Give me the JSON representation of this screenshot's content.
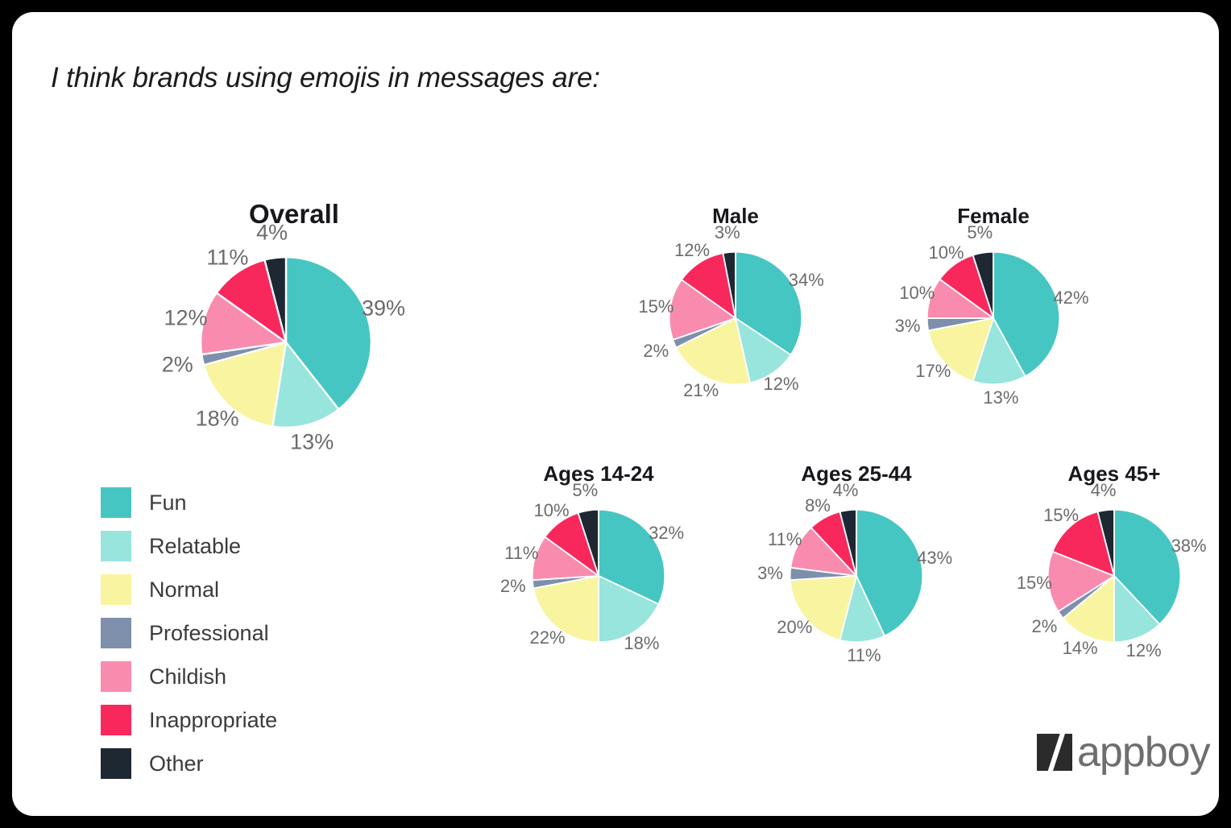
{
  "title": "I think brands using emojis in messages are:",
  "logo": {
    "text": "appboy",
    "mark": "appboy-slash-mark"
  },
  "legend": {
    "items": [
      {
        "label": "Fun",
        "color": "#46C6C2"
      },
      {
        "label": "Relatable",
        "color": "#97E5DC"
      },
      {
        "label": "Normal",
        "color": "#F9F4A0"
      },
      {
        "label": "Professional",
        "color": "#7E8FAB"
      },
      {
        "label": "Childish",
        "color": "#F98CAE"
      },
      {
        "label": "Inappropriate",
        "color": "#F8285C"
      },
      {
        "label": "Other",
        "color": "#1E2833"
      }
    ]
  },
  "chart_data": [
    {
      "type": "pie",
      "title": "Overall",
      "categories": [
        "Fun",
        "Relatable",
        "Normal",
        "Professional",
        "Childish",
        "Inappropriate",
        "Other"
      ],
      "values": [
        39,
        13,
        18,
        2,
        12,
        11,
        4
      ],
      "labels": [
        "39%",
        "13%",
        "18%",
        "2%",
        "12%",
        "11%",
        "4%"
      ],
      "colors": [
        "#46C6C2",
        "#97E5DC",
        "#F9F4A0",
        "#7E8FAB",
        "#F98CAE",
        "#F8285C",
        "#1E2833"
      ],
      "start_angle_deg": 0,
      "direction": "clockwise",
      "units": "percent"
    },
    {
      "type": "pie",
      "title": "Male",
      "categories": [
        "Fun",
        "Relatable",
        "Normal",
        "Professional",
        "Childish",
        "Inappropriate",
        "Other"
      ],
      "values": [
        34,
        12,
        21,
        2,
        15,
        12,
        3
      ],
      "labels": [
        "34%",
        "12%",
        "21%",
        "2%",
        "15%",
        "12%",
        "3%"
      ],
      "colors": [
        "#46C6C2",
        "#97E5DC",
        "#F9F4A0",
        "#7E8FAB",
        "#F98CAE",
        "#F8285C",
        "#1E2833"
      ],
      "start_angle_deg": 0,
      "direction": "clockwise",
      "units": "percent"
    },
    {
      "type": "pie",
      "title": "Female",
      "categories": [
        "Fun",
        "Relatable",
        "Normal",
        "Professional",
        "Childish",
        "Inappropriate",
        "Other"
      ],
      "values": [
        42,
        13,
        17,
        3,
        10,
        10,
        5
      ],
      "labels": [
        "42%",
        "13%",
        "17%",
        "3%",
        "10%",
        "10%",
        "5%"
      ],
      "colors": [
        "#46C6C2",
        "#97E5DC",
        "#F9F4A0",
        "#7E8FAB",
        "#F98CAE",
        "#F8285C",
        "#1E2833"
      ],
      "start_angle_deg": 0,
      "direction": "clockwise",
      "units": "percent"
    },
    {
      "type": "pie",
      "title": "Ages 14-24",
      "categories": [
        "Fun",
        "Relatable",
        "Normal",
        "Professional",
        "Childish",
        "Inappropriate",
        "Other"
      ],
      "values": [
        32,
        18,
        22,
        2,
        11,
        10,
        5
      ],
      "labels": [
        "32%",
        "18%",
        "22%",
        "2%",
        "11%",
        "10%",
        "5%"
      ],
      "colors": [
        "#46C6C2",
        "#97E5DC",
        "#F9F4A0",
        "#7E8FAB",
        "#F98CAE",
        "#F8285C",
        "#1E2833"
      ],
      "start_angle_deg": 0,
      "direction": "clockwise",
      "units": "percent"
    },
    {
      "type": "pie",
      "title": "Ages 25-44",
      "categories": [
        "Fun",
        "Relatable",
        "Normal",
        "Professional",
        "Childish",
        "Inappropriate",
        "Other"
      ],
      "values": [
        43,
        11,
        20,
        3,
        11,
        8,
        4
      ],
      "labels": [
        "43%",
        "11%",
        "20%",
        "3%",
        "11%",
        "8%",
        "4%"
      ],
      "colors": [
        "#46C6C2",
        "#97E5DC",
        "#F9F4A0",
        "#7E8FAB",
        "#F98CAE",
        "#F8285C",
        "#1E2833"
      ],
      "start_angle_deg": 0,
      "direction": "clockwise",
      "units": "percent"
    },
    {
      "type": "pie",
      "title": "Ages 45+",
      "categories": [
        "Fun",
        "Relatable",
        "Normal",
        "Professional",
        "Childish",
        "Inappropriate",
        "Other"
      ],
      "values": [
        38,
        12,
        14,
        2,
        15,
        15,
        4
      ],
      "labels": [
        "38%",
        "12%",
        "14%",
        "2%",
        "15%",
        "15%",
        "4%"
      ],
      "colors": [
        "#46C6C2",
        "#97E5DC",
        "#F9F4A0",
        "#7E8FAB",
        "#F98CAE",
        "#F8285C",
        "#1E2833"
      ],
      "start_angle_deg": 0,
      "direction": "clockwise",
      "units": "percent"
    }
  ]
}
